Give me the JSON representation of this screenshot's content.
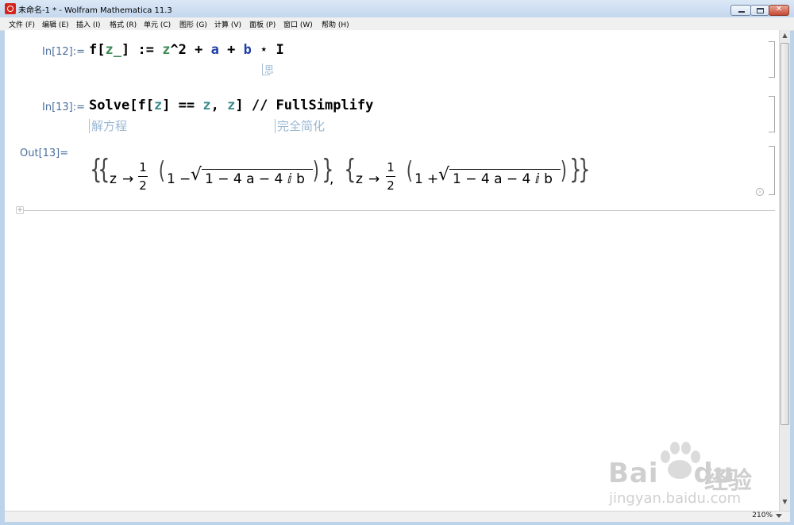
{
  "window": {
    "title": "未命名-1 * - Wolfram Mathematica 11.3",
    "buttons": {
      "close": "✕"
    }
  },
  "menu": [
    "文件 (F)",
    "编辑 (E)",
    "插入 (I)",
    "格式 (R)",
    "单元 (C)",
    "图形 (G)",
    "计算 (V)",
    "面板 (P)",
    "窗口 (W)",
    "帮助 (H)"
  ],
  "cells": {
    "in12": {
      "label": "In[12]:=",
      "tokens": [
        "f",
        "[",
        "z_",
        "]",
        " := ",
        "z",
        "^2 + ",
        "a",
        " + ",
        "b",
        " ⋆ I"
      ],
      "hint": "思"
    },
    "in13": {
      "label": "In[13]:=",
      "tokens": [
        "Solve",
        "[",
        "f",
        "[",
        "z",
        "] == ",
        "z",
        ", ",
        "z",
        "] // ",
        "FullSimplify"
      ],
      "hint_solve": "解方程",
      "hint_simplify": "完全简化"
    },
    "out13": {
      "label": "Out[13]=",
      "open_outer": "{",
      "open_inner": "{",
      "z": "z",
      "arrow": "→",
      "frac_num": "1",
      "frac_den": "2",
      "paren_open": "(",
      "one": "1",
      "minus": "−",
      "plus": "+",
      "radicand": "1 − 4 a − 4 ⅈ b",
      "paren_close": ")",
      "close_inner": "}",
      "comma": ",",
      "close_outer": "}"
    }
  },
  "status": {
    "zoom": "210%"
  },
  "watermark": {
    "brand": "Bai",
    "brand2": "du",
    "cn": "经验",
    "url": "jingyan.baidu.com"
  }
}
